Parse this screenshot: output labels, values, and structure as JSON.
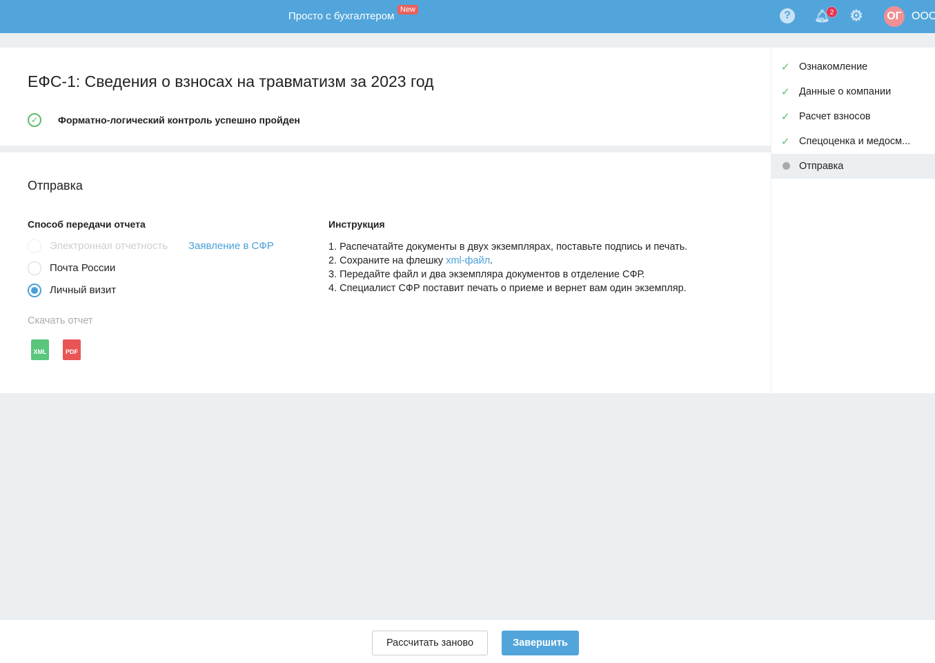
{
  "header": {
    "brand": "Просто с бухгалтером",
    "new_badge": "New",
    "notifications_count": "2",
    "avatar": "ОГ",
    "org": "ООО"
  },
  "report": {
    "title": "ЕФС-1: Сведения о взносах на травматизм за 2023 год",
    "check_status": "Форматно-логический контроль успешно пройден"
  },
  "send": {
    "heading": "Отправка",
    "method_label": "Способ передачи отчета",
    "options": [
      {
        "label": "Электронная отчетность",
        "disabled": true,
        "selected": false
      },
      {
        "label": "Почта России",
        "disabled": false,
        "selected": false
      },
      {
        "label": "Личный визит",
        "disabled": false,
        "selected": true
      }
    ],
    "sfr_link": "Заявление в СФР",
    "download_label": "Скачать отчет",
    "files": [
      "XML",
      "PDF"
    ]
  },
  "instructions": {
    "title": "Инструкция",
    "step1": "1. Распечатайте документы в двух экземплярах, поставьте подпись и печать.",
    "step2_pre": "2. Сохраните на флешку ",
    "step2_link": "xml-файл",
    "step2_post": ".",
    "step3": "3. Передайте файл и два экземпляра документов в отделение СФР.",
    "step4": "4. Специалист СФР поставит печать о приеме и вернет вам один экземпляр."
  },
  "steps": [
    {
      "label": "Ознакомление",
      "done": true
    },
    {
      "label": "Данные о компании",
      "done": true
    },
    {
      "label": "Расчет взносов",
      "done": true
    },
    {
      "label": "Спецоценка и медосм...",
      "done": true
    },
    {
      "label": "Отправка",
      "done": false,
      "current": true
    }
  ],
  "footer": {
    "recalc": "Рассчитать заново",
    "finish": "Завершить"
  }
}
